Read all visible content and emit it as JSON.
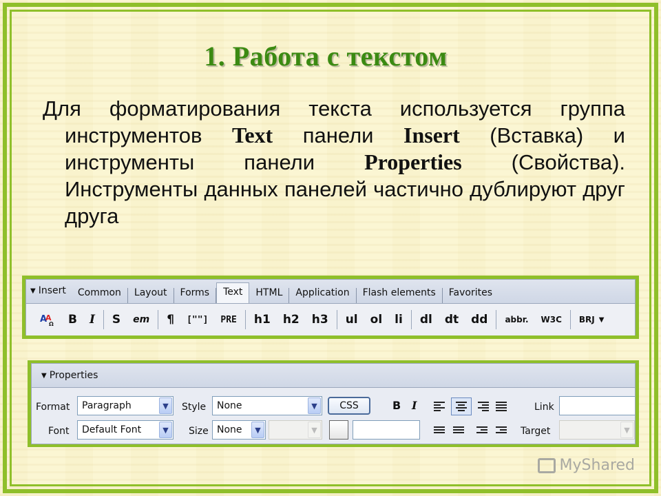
{
  "slide": {
    "title": "1. Работа с текстом",
    "para_part1": "Для форматирования текста используется группа инструментов ",
    "para_bold1": "Text",
    "para_part2": " панели ",
    "para_bold2": "Insert",
    "para_part3": " (Вставка) и инструменты панели ",
    "para_bold3": "Properties",
    "para_part4": " (Свойства). Инструменты данных панелей частично дублируют друг друга",
    "watermark": "MyShared"
  },
  "insert_panel": {
    "header": "Insert",
    "tabs": [
      "Common",
      "Layout",
      "Forms",
      "Text",
      "HTML",
      "Application",
      "Flash elements",
      "Favorites"
    ],
    "active_tab": "Text",
    "buttons": [
      "B",
      "I",
      "S",
      "em",
      "¶",
      "[\"\"]",
      "PRE",
      "h1",
      "h2",
      "h3",
      "ul",
      "ol",
      "li",
      "dl",
      "dt",
      "dd",
      "abbr.",
      "W3C",
      "BRJ"
    ]
  },
  "properties_panel": {
    "header": "Properties",
    "format_label": "Format",
    "format_value": "Paragraph",
    "style_label": "Style",
    "style_value": "None",
    "css_button": "CSS",
    "bold": "B",
    "italic": "I",
    "link_label": "Link",
    "font_label": "Font",
    "font_value": "Default Font",
    "size_label": "Size",
    "size_value": "None",
    "target_label": "Target"
  },
  "colors": {
    "frame": "#8fbf2a",
    "title": "#3b8a12",
    "background": "#fbf6d3"
  }
}
